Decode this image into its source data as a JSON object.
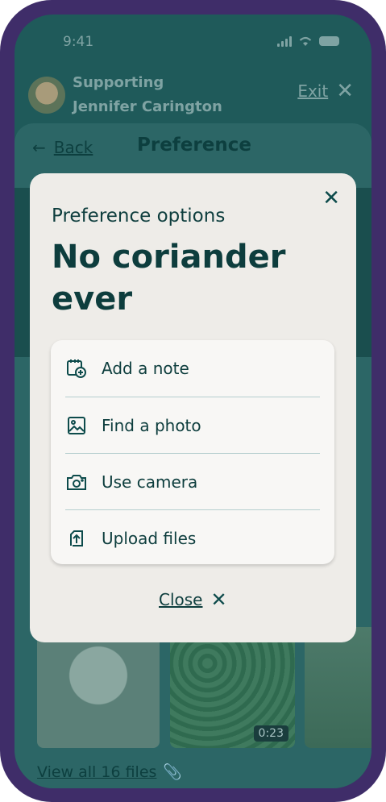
{
  "status_bar": {
    "time": "9:41"
  },
  "support": {
    "line1": "Supporting",
    "line2": "Jennifer Carington",
    "exit_label": "Exit"
  },
  "nav": {
    "back_label": "Back",
    "title": "Preference"
  },
  "modal": {
    "subtitle": "Preference options",
    "title": "No coriander ever",
    "options": [
      {
        "label": "Add a note",
        "icon": "calendar-add-icon"
      },
      {
        "label": "Find a photo",
        "icon": "image-icon"
      },
      {
        "label": "Use camera",
        "icon": "camera-icon"
      },
      {
        "label": "Upload files",
        "icon": "upload-icon"
      }
    ],
    "close_label": "Close"
  },
  "media": {
    "video_duration": "0:23",
    "view_all_label": "View all 16 files"
  },
  "colors": {
    "frame": "#3f2d69",
    "dim_screen": "#1f5a5a",
    "modal_bg": "#eeece8",
    "text_dark": "#0d3d3d"
  }
}
